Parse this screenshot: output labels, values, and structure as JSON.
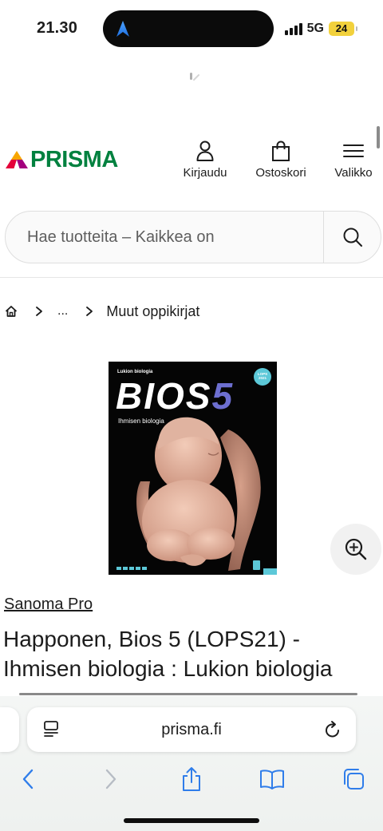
{
  "status_bar": {
    "time": "21.30",
    "network": "5G",
    "battery": "24"
  },
  "header": {
    "logo_text": "PRISMA",
    "login_label": "Kirjaudu",
    "cart_label": "Ostoskori",
    "menu_label": "Valikko"
  },
  "search": {
    "placeholder": "Hae tuotteita – Kaikkea on"
  },
  "breadcrumb": {
    "ellipsis": "...",
    "current": "Muut oppikirjat"
  },
  "product": {
    "cover": {
      "series": "Lukion biologia",
      "title_word": "BIOS",
      "title_number": "5",
      "subtitle": "Ihmisen biologia",
      "badge": "LOPS 2021"
    },
    "brand": "Sanoma Pro",
    "title": "Happonen, Bios 5 (LOPS21) - Ihmisen biologia : Lukion biologia"
  },
  "browser": {
    "url": "prisma.fi"
  },
  "colors": {
    "brand_green": "#00813f",
    "accent_blue": "#2f7dea"
  }
}
